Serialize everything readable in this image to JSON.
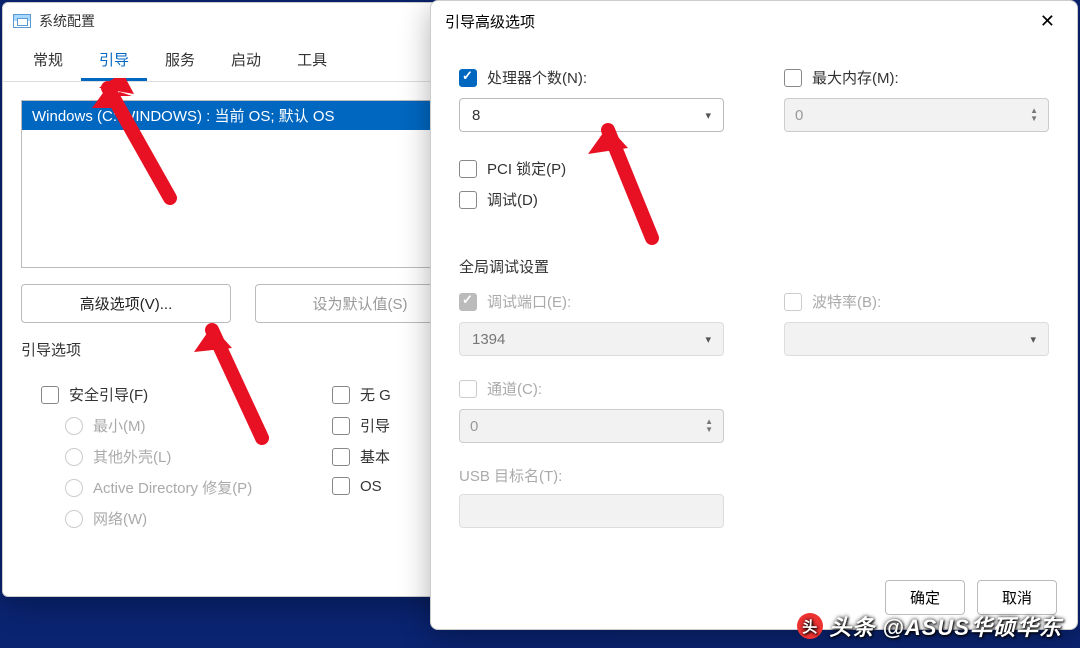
{
  "msconfig": {
    "title": "系统配置",
    "tabs": [
      "常规",
      "引导",
      "服务",
      "启动",
      "工具"
    ],
    "active_tab": 1,
    "list_item": "Windows      (C:\\WINDOWS) : 当前 OS; 默认 OS",
    "btn_advanced": "高级选项(V)...",
    "btn_default": "设为默认值(S)",
    "group_title": "引导选项",
    "safe_boot": "安全引导(F)",
    "radio_min": "最小(M)",
    "radio_shell": "其他外壳(L)",
    "radio_ad": "Active Directory 修复(P)",
    "radio_net": "网络(W)",
    "chk_nogui": "无 G",
    "chk_bootlog": "引导",
    "chk_base": "基本",
    "chk_os": "OS"
  },
  "adv": {
    "title": "引导高级选项",
    "chk_cpu": "处理器个数(N):",
    "cpu_val": "8",
    "chk_mem": "最大内存(M):",
    "mem_val": "0",
    "chk_pci": "PCI 锁定(P)",
    "chk_debug": "调试(D)",
    "sect_global": "全局调试设置",
    "chk_port": "调试端口(E):",
    "port_val": "1394",
    "chk_baud": "波特率(B):",
    "chk_chan": "通道(C):",
    "chan_val": "0",
    "usb_label": "USB 目标名(T):",
    "btn_ok": "确定",
    "btn_cancel": "取消"
  },
  "watermark": "头条 @ASUS华硕华东"
}
